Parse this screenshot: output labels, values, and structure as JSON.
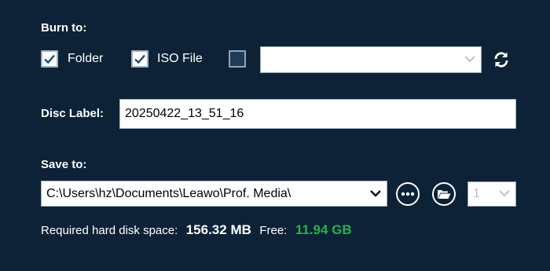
{
  "burn_to": {
    "label": "Burn to:",
    "folder": {
      "label": "Folder",
      "checked": true
    },
    "iso_file": {
      "label": "ISO File",
      "checked": true
    },
    "disc": {
      "checked": false,
      "selected_value": ""
    }
  },
  "disc_label": {
    "label": "Disc Label:",
    "value": "20250422_13_51_16"
  },
  "save_to": {
    "label": "Save to:",
    "path": "C:\\Users\\hz\\Documents\\Leawo\\Prof. Media\\",
    "copies": "1"
  },
  "disk_space": {
    "required_label": "Required hard disk space:",
    "required_value": "156.32 MB",
    "free_label": "Free:",
    "free_value": "11.94 GB"
  },
  "icons": {
    "refresh": "refresh-icon",
    "more": "ellipsis-icon",
    "open_folder": "folder-open-icon",
    "dropdown": "chevron-down-icon"
  },
  "colors": {
    "background": "#0d2236",
    "free_space": "#22b24c"
  }
}
